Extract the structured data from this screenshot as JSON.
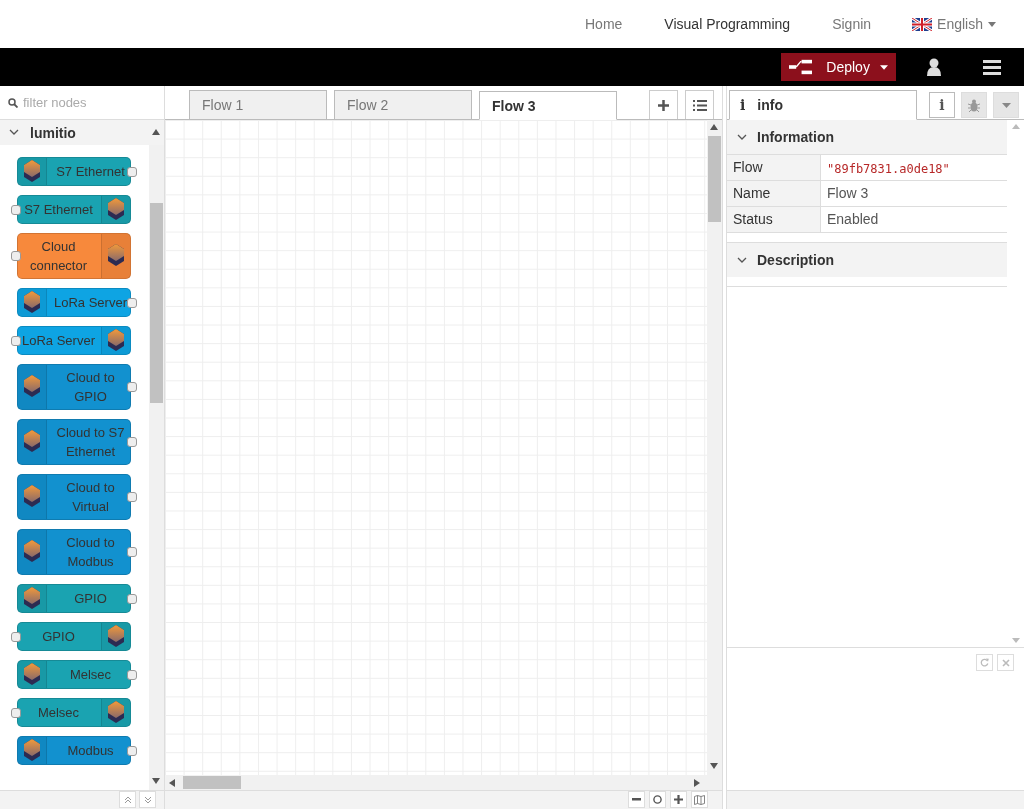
{
  "top_nav": {
    "links": [
      {
        "label": "Home",
        "selected": false
      },
      {
        "label": "Visual Programming",
        "selected": true
      },
      {
        "label": "Signin",
        "selected": false
      }
    ],
    "language": "English"
  },
  "header": {
    "deploy": "Deploy"
  },
  "palette": {
    "filter_placeholder": "filter nodes",
    "category": {
      "name": "lumitio",
      "expanded": true
    },
    "nodes": [
      {
        "label": "S7 Ethernet",
        "kind": "source",
        "color": "#1aa3b1"
      },
      {
        "label": "S7 Ethernet",
        "kind": "sink",
        "color": "#1aa3b1"
      },
      {
        "label": "Cloud connector",
        "kind": "sink",
        "color": "#f7893c"
      },
      {
        "label": "LoRa Server",
        "kind": "source",
        "color": "#0ea4e3"
      },
      {
        "label": "LoRa Server",
        "kind": "sink",
        "color": "#0ea4e3"
      },
      {
        "label": "Cloud to GPIO",
        "kind": "source",
        "color": "#1291cf"
      },
      {
        "label": "Cloud to S7 Ethernet",
        "kind": "source",
        "color": "#1291cf"
      },
      {
        "label": "Cloud to Virtual",
        "kind": "source",
        "color": "#1291cf"
      },
      {
        "label": "Cloud to Modbus",
        "kind": "source",
        "color": "#1291cf"
      },
      {
        "label": "GPIO",
        "kind": "source",
        "color": "#1aa3b1"
      },
      {
        "label": "GPIO",
        "kind": "sink",
        "color": "#1aa3b1"
      },
      {
        "label": "Melsec",
        "kind": "source",
        "color": "#1aa3b1"
      },
      {
        "label": "Melsec",
        "kind": "sink",
        "color": "#1aa3b1"
      },
      {
        "label": "Modbus",
        "kind": "source",
        "color": "#1291cf"
      }
    ]
  },
  "workspace": {
    "tabs": [
      {
        "label": "Flow 1",
        "selected": false
      },
      {
        "label": "Flow 2",
        "selected": false
      },
      {
        "label": "Flow 3",
        "selected": true
      }
    ]
  },
  "sidebar": {
    "tab": "info",
    "tab_icon": "i",
    "info_button": "i",
    "sections": [
      {
        "title": "Information",
        "expanded": true,
        "rows": [
          {
            "key": "Flow",
            "value": "\"89fb7831.a0de18\"",
            "kind": "code"
          },
          {
            "key": "Name",
            "value": "Flow 3",
            "kind": "text"
          },
          {
            "key": "Status",
            "value": "Enabled",
            "kind": "text"
          }
        ]
      },
      {
        "title": "Description",
        "expanded": true
      }
    ]
  }
}
